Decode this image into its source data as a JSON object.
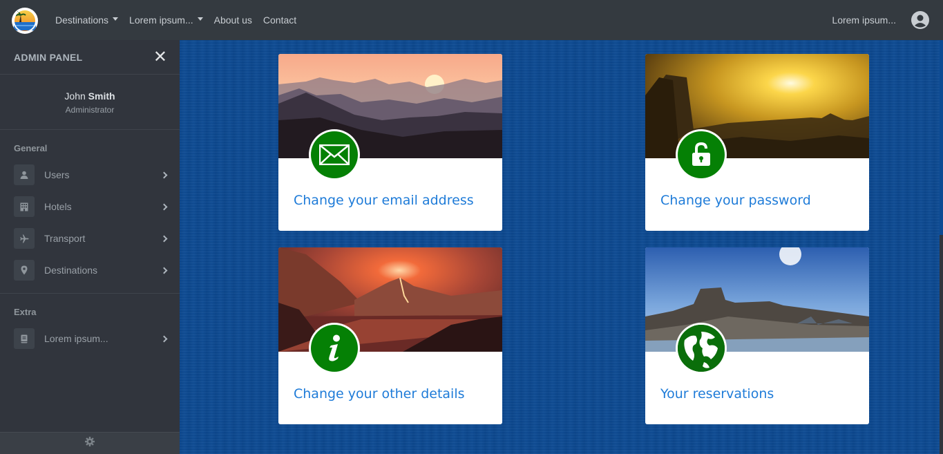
{
  "navbar": {
    "logo_icon": "sunset-beach-logo",
    "items": [
      {
        "label": "Destinations",
        "dropdown": true
      },
      {
        "label": "Lorem ipsum...",
        "dropdown": true
      },
      {
        "label": "About us",
        "dropdown": false
      },
      {
        "label": "Contact",
        "dropdown": false
      }
    ],
    "right_text": "Lorem ipsum...",
    "user_icon": "user-circle-icon"
  },
  "sidebar": {
    "title": "ADMIN PANEL",
    "close_icon": "close-icon",
    "user": {
      "first_name": "John",
      "last_name": "Smith",
      "role": "Administrator"
    },
    "sections": [
      {
        "title": "General",
        "items": [
          {
            "label": "Users",
            "icon": "user-icon"
          },
          {
            "label": "Hotels",
            "icon": "building-icon"
          },
          {
            "label": "Transport",
            "icon": "plane-icon"
          },
          {
            "label": "Destinations",
            "icon": "map-marker-icon"
          }
        ]
      },
      {
        "title": "Extra",
        "items": [
          {
            "label": "Lorem ipsum...",
            "icon": "book-icon"
          }
        ]
      }
    ],
    "footer_icon": "gear-icon"
  },
  "cards": [
    {
      "title": "Change your email address",
      "icon": "envelope-icon",
      "image": "sunset-mountains"
    },
    {
      "title": "Change your password",
      "icon": "lock-icon",
      "image": "golden-canyon"
    },
    {
      "title": "Change your other details",
      "icon": "info-icon",
      "image": "volcano-lake"
    },
    {
      "title": "Your reservations",
      "icon": "globe-icon",
      "image": "desert-mesa"
    }
  ],
  "colors": {
    "navbar_bg": "#343a40",
    "sidebar_bg": "#31353d",
    "main_bg": "#0c4a93",
    "badge_green": "#058005",
    "link_blue": "#1e7bd8"
  }
}
